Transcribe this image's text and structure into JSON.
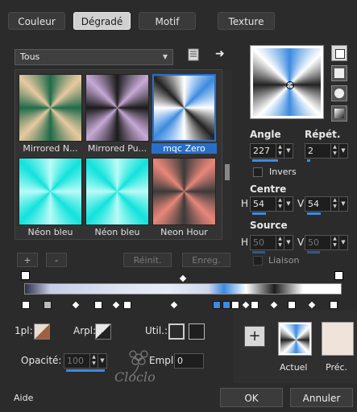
{
  "tabs": [
    {
      "label": "Couleur"
    },
    {
      "label": "Dégradé"
    },
    {
      "label": "Motif"
    },
    {
      "label": "Texture"
    }
  ],
  "category_select": {
    "value": "Tous"
  },
  "gradients": [
    {
      "label": "Mirrored N..."
    },
    {
      "label": "Mirrored Pu..."
    },
    {
      "label": "mqc Zero",
      "selected": true
    },
    {
      "label": "Néon bleu"
    },
    {
      "label": "Néon bleu"
    },
    {
      "label": "Neon Hour"
    }
  ],
  "list_buttons": {
    "add": "+",
    "remove": "-",
    "reset": "Réinit.",
    "save": "Enreg."
  },
  "angle": {
    "label": "Angle",
    "value": "227"
  },
  "repeat": {
    "label": "Répét.",
    "value": "2"
  },
  "invert": {
    "label": "Invers"
  },
  "center": {
    "label": "Centre",
    "h_label": "H",
    "h_value": "54",
    "v_label": "V",
    "v_value": "54"
  },
  "source": {
    "label": "Source",
    "h_label": "H",
    "h_value": "50",
    "v_label": "V",
    "v_value": "50"
  },
  "link": {
    "label": "Liaison"
  },
  "bottom": {
    "one_pl": "1pl:",
    "arpl": "Arpl:",
    "util": "Util.:",
    "opacity_label": "Opacité:",
    "opacity_value": "100",
    "empl_label": "Empl.:",
    "empl_value": "0",
    "current_label": "Actuel",
    "previous_label": "Préc.",
    "add_symbol": "+"
  },
  "watermark": {
    "text": "Cloclo"
  },
  "footer": {
    "help": "Aide",
    "ok": "OK",
    "cancel": "Annuler"
  },
  "colors": {
    "accent": "#2a6fc7",
    "background": "#2b2b2b"
  }
}
